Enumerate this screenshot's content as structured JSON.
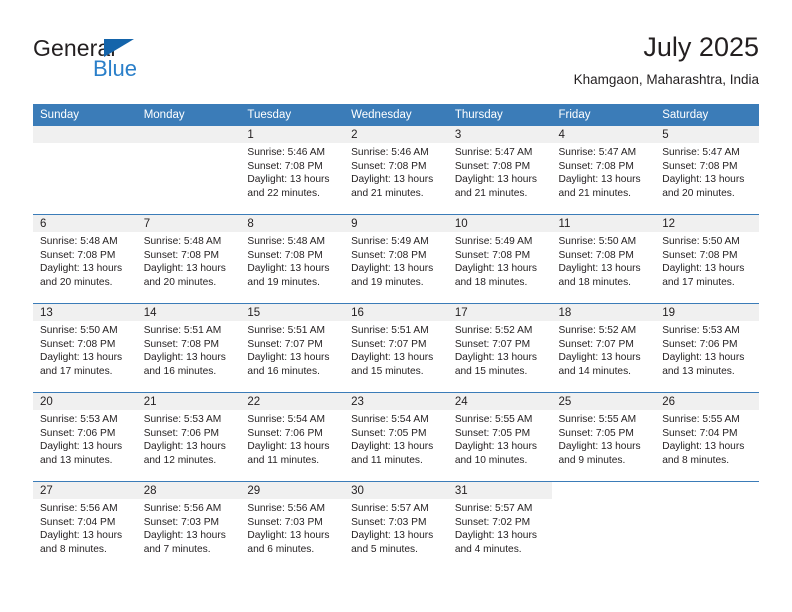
{
  "brand": {
    "name_part1": "General",
    "name_part2": "Blue",
    "triangle_color": "#1464aa",
    "blue_color": "#2a7fc9"
  },
  "header": {
    "title": "July 2025",
    "subtitle": "Khamgaon, Maharashtra, India"
  },
  "colors": {
    "header_row_bg": "#3b7cb8",
    "day_strip_bg": "#f0f0f0",
    "text": "#231f20"
  },
  "weekdays": [
    "Sunday",
    "Monday",
    "Tuesday",
    "Wednesday",
    "Thursday",
    "Friday",
    "Saturday"
  ],
  "weeks": [
    [
      {
        "day": "",
        "empty": true,
        "sunrise": "",
        "sunset": "",
        "daylight1": "",
        "daylight2": ""
      },
      {
        "day": "",
        "empty": true,
        "sunrise": "",
        "sunset": "",
        "daylight1": "",
        "daylight2": ""
      },
      {
        "day": "1",
        "sunrise": "Sunrise: 5:46 AM",
        "sunset": "Sunset: 7:08 PM",
        "daylight1": "Daylight: 13 hours",
        "daylight2": "and 22 minutes."
      },
      {
        "day": "2",
        "sunrise": "Sunrise: 5:46 AM",
        "sunset": "Sunset: 7:08 PM",
        "daylight1": "Daylight: 13 hours",
        "daylight2": "and 21 minutes."
      },
      {
        "day": "3",
        "sunrise": "Sunrise: 5:47 AM",
        "sunset": "Sunset: 7:08 PM",
        "daylight1": "Daylight: 13 hours",
        "daylight2": "and 21 minutes."
      },
      {
        "day": "4",
        "sunrise": "Sunrise: 5:47 AM",
        "sunset": "Sunset: 7:08 PM",
        "daylight1": "Daylight: 13 hours",
        "daylight2": "and 21 minutes."
      },
      {
        "day": "5",
        "sunrise": "Sunrise: 5:47 AM",
        "sunset": "Sunset: 7:08 PM",
        "daylight1": "Daylight: 13 hours",
        "daylight2": "and 20 minutes."
      }
    ],
    [
      {
        "day": "6",
        "sunrise": "Sunrise: 5:48 AM",
        "sunset": "Sunset: 7:08 PM",
        "daylight1": "Daylight: 13 hours",
        "daylight2": "and 20 minutes."
      },
      {
        "day": "7",
        "sunrise": "Sunrise: 5:48 AM",
        "sunset": "Sunset: 7:08 PM",
        "daylight1": "Daylight: 13 hours",
        "daylight2": "and 20 minutes."
      },
      {
        "day": "8",
        "sunrise": "Sunrise: 5:48 AM",
        "sunset": "Sunset: 7:08 PM",
        "daylight1": "Daylight: 13 hours",
        "daylight2": "and 19 minutes."
      },
      {
        "day": "9",
        "sunrise": "Sunrise: 5:49 AM",
        "sunset": "Sunset: 7:08 PM",
        "daylight1": "Daylight: 13 hours",
        "daylight2": "and 19 minutes."
      },
      {
        "day": "10",
        "sunrise": "Sunrise: 5:49 AM",
        "sunset": "Sunset: 7:08 PM",
        "daylight1": "Daylight: 13 hours",
        "daylight2": "and 18 minutes."
      },
      {
        "day": "11",
        "sunrise": "Sunrise: 5:50 AM",
        "sunset": "Sunset: 7:08 PM",
        "daylight1": "Daylight: 13 hours",
        "daylight2": "and 18 minutes."
      },
      {
        "day": "12",
        "sunrise": "Sunrise: 5:50 AM",
        "sunset": "Sunset: 7:08 PM",
        "daylight1": "Daylight: 13 hours",
        "daylight2": "and 17 minutes."
      }
    ],
    [
      {
        "day": "13",
        "sunrise": "Sunrise: 5:50 AM",
        "sunset": "Sunset: 7:08 PM",
        "daylight1": "Daylight: 13 hours",
        "daylight2": "and 17 minutes."
      },
      {
        "day": "14",
        "sunrise": "Sunrise: 5:51 AM",
        "sunset": "Sunset: 7:08 PM",
        "daylight1": "Daylight: 13 hours",
        "daylight2": "and 16 minutes."
      },
      {
        "day": "15",
        "sunrise": "Sunrise: 5:51 AM",
        "sunset": "Sunset: 7:07 PM",
        "daylight1": "Daylight: 13 hours",
        "daylight2": "and 16 minutes."
      },
      {
        "day": "16",
        "sunrise": "Sunrise: 5:51 AM",
        "sunset": "Sunset: 7:07 PM",
        "daylight1": "Daylight: 13 hours",
        "daylight2": "and 15 minutes."
      },
      {
        "day": "17",
        "sunrise": "Sunrise: 5:52 AM",
        "sunset": "Sunset: 7:07 PM",
        "daylight1": "Daylight: 13 hours",
        "daylight2": "and 15 minutes."
      },
      {
        "day": "18",
        "sunrise": "Sunrise: 5:52 AM",
        "sunset": "Sunset: 7:07 PM",
        "daylight1": "Daylight: 13 hours",
        "daylight2": "and 14 minutes."
      },
      {
        "day": "19",
        "sunrise": "Sunrise: 5:53 AM",
        "sunset": "Sunset: 7:06 PM",
        "daylight1": "Daylight: 13 hours",
        "daylight2": "and 13 minutes."
      }
    ],
    [
      {
        "day": "20",
        "sunrise": "Sunrise: 5:53 AM",
        "sunset": "Sunset: 7:06 PM",
        "daylight1": "Daylight: 13 hours",
        "daylight2": "and 13 minutes."
      },
      {
        "day": "21",
        "sunrise": "Sunrise: 5:53 AM",
        "sunset": "Sunset: 7:06 PM",
        "daylight1": "Daylight: 13 hours",
        "daylight2": "and 12 minutes."
      },
      {
        "day": "22",
        "sunrise": "Sunrise: 5:54 AM",
        "sunset": "Sunset: 7:06 PM",
        "daylight1": "Daylight: 13 hours",
        "daylight2": "and 11 minutes."
      },
      {
        "day": "23",
        "sunrise": "Sunrise: 5:54 AM",
        "sunset": "Sunset: 7:05 PM",
        "daylight1": "Daylight: 13 hours",
        "daylight2": "and 11 minutes."
      },
      {
        "day": "24",
        "sunrise": "Sunrise: 5:55 AM",
        "sunset": "Sunset: 7:05 PM",
        "daylight1": "Daylight: 13 hours",
        "daylight2": "and 10 minutes."
      },
      {
        "day": "25",
        "sunrise": "Sunrise: 5:55 AM",
        "sunset": "Sunset: 7:05 PM",
        "daylight1": "Daylight: 13 hours",
        "daylight2": "and 9 minutes."
      },
      {
        "day": "26",
        "sunrise": "Sunrise: 5:55 AM",
        "sunset": "Sunset: 7:04 PM",
        "daylight1": "Daylight: 13 hours",
        "daylight2": "and 8 minutes."
      }
    ],
    [
      {
        "day": "27",
        "sunrise": "Sunrise: 5:56 AM",
        "sunset": "Sunset: 7:04 PM",
        "daylight1": "Daylight: 13 hours",
        "daylight2": "and 8 minutes."
      },
      {
        "day": "28",
        "sunrise": "Sunrise: 5:56 AM",
        "sunset": "Sunset: 7:03 PM",
        "daylight1": "Daylight: 13 hours",
        "daylight2": "and 7 minutes."
      },
      {
        "day": "29",
        "sunrise": "Sunrise: 5:56 AM",
        "sunset": "Sunset: 7:03 PM",
        "daylight1": "Daylight: 13 hours",
        "daylight2": "and 6 minutes."
      },
      {
        "day": "30",
        "sunrise": "Sunrise: 5:57 AM",
        "sunset": "Sunset: 7:03 PM",
        "daylight1": "Daylight: 13 hours",
        "daylight2": "and 5 minutes."
      },
      {
        "day": "31",
        "sunrise": "Sunrise: 5:57 AM",
        "sunset": "Sunset: 7:02 PM",
        "daylight1": "Daylight: 13 hours",
        "daylight2": "and 4 minutes."
      },
      {
        "day": "",
        "empty": true,
        "blank_strip": true,
        "sunrise": "",
        "sunset": "",
        "daylight1": "",
        "daylight2": ""
      },
      {
        "day": "",
        "empty": true,
        "blank_strip": true,
        "sunrise": "",
        "sunset": "",
        "daylight1": "",
        "daylight2": ""
      }
    ]
  ]
}
